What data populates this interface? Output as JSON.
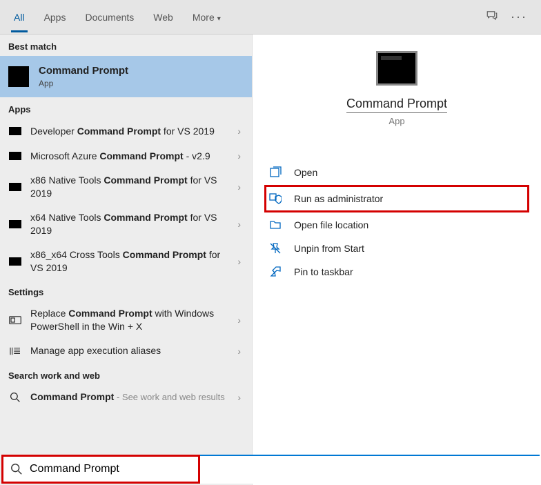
{
  "tabs": {
    "all": "All",
    "apps": "Apps",
    "documents": "Documents",
    "web": "Web",
    "more": "More"
  },
  "sections": {
    "best": "Best match",
    "apps": "Apps",
    "settings": "Settings",
    "searchweb": "Search work and web"
  },
  "best": {
    "title": "Command Prompt",
    "sub": "App"
  },
  "apps": [
    {
      "pre": "Developer ",
      "hl": "Command Prompt",
      "post": " for VS 2019"
    },
    {
      "pre": "Microsoft Azure ",
      "hl": "Command Prompt",
      "post": " - v2.9"
    },
    {
      "pre": "x86 Native Tools ",
      "hl": "Command Prompt",
      "post": " for VS 2019"
    },
    {
      "pre": "x64 Native Tools ",
      "hl": "Command Prompt",
      "post": " for VS 2019"
    },
    {
      "pre": "x86_x64 Cross Tools ",
      "hl": "Command Prompt",
      "post": " for VS 2019"
    }
  ],
  "settings": [
    {
      "pre": "Replace ",
      "hl": "Command Prompt",
      "post": " with Windows PowerShell in the Win + X"
    },
    {
      "pre": "Manage app execution aliases",
      "hl": "",
      "post": ""
    }
  ],
  "web": {
    "pre": "",
    "hl": "Command Prompt",
    "post": "",
    "hint": " - See work and web results"
  },
  "detail": {
    "title": "Command Prompt",
    "sub": "App"
  },
  "actions": {
    "open": "Open",
    "admin": "Run as administrator",
    "loc": "Open file location",
    "unpin": "Unpin from Start",
    "pin": "Pin to taskbar"
  },
  "search": {
    "value": "Command Prompt"
  }
}
